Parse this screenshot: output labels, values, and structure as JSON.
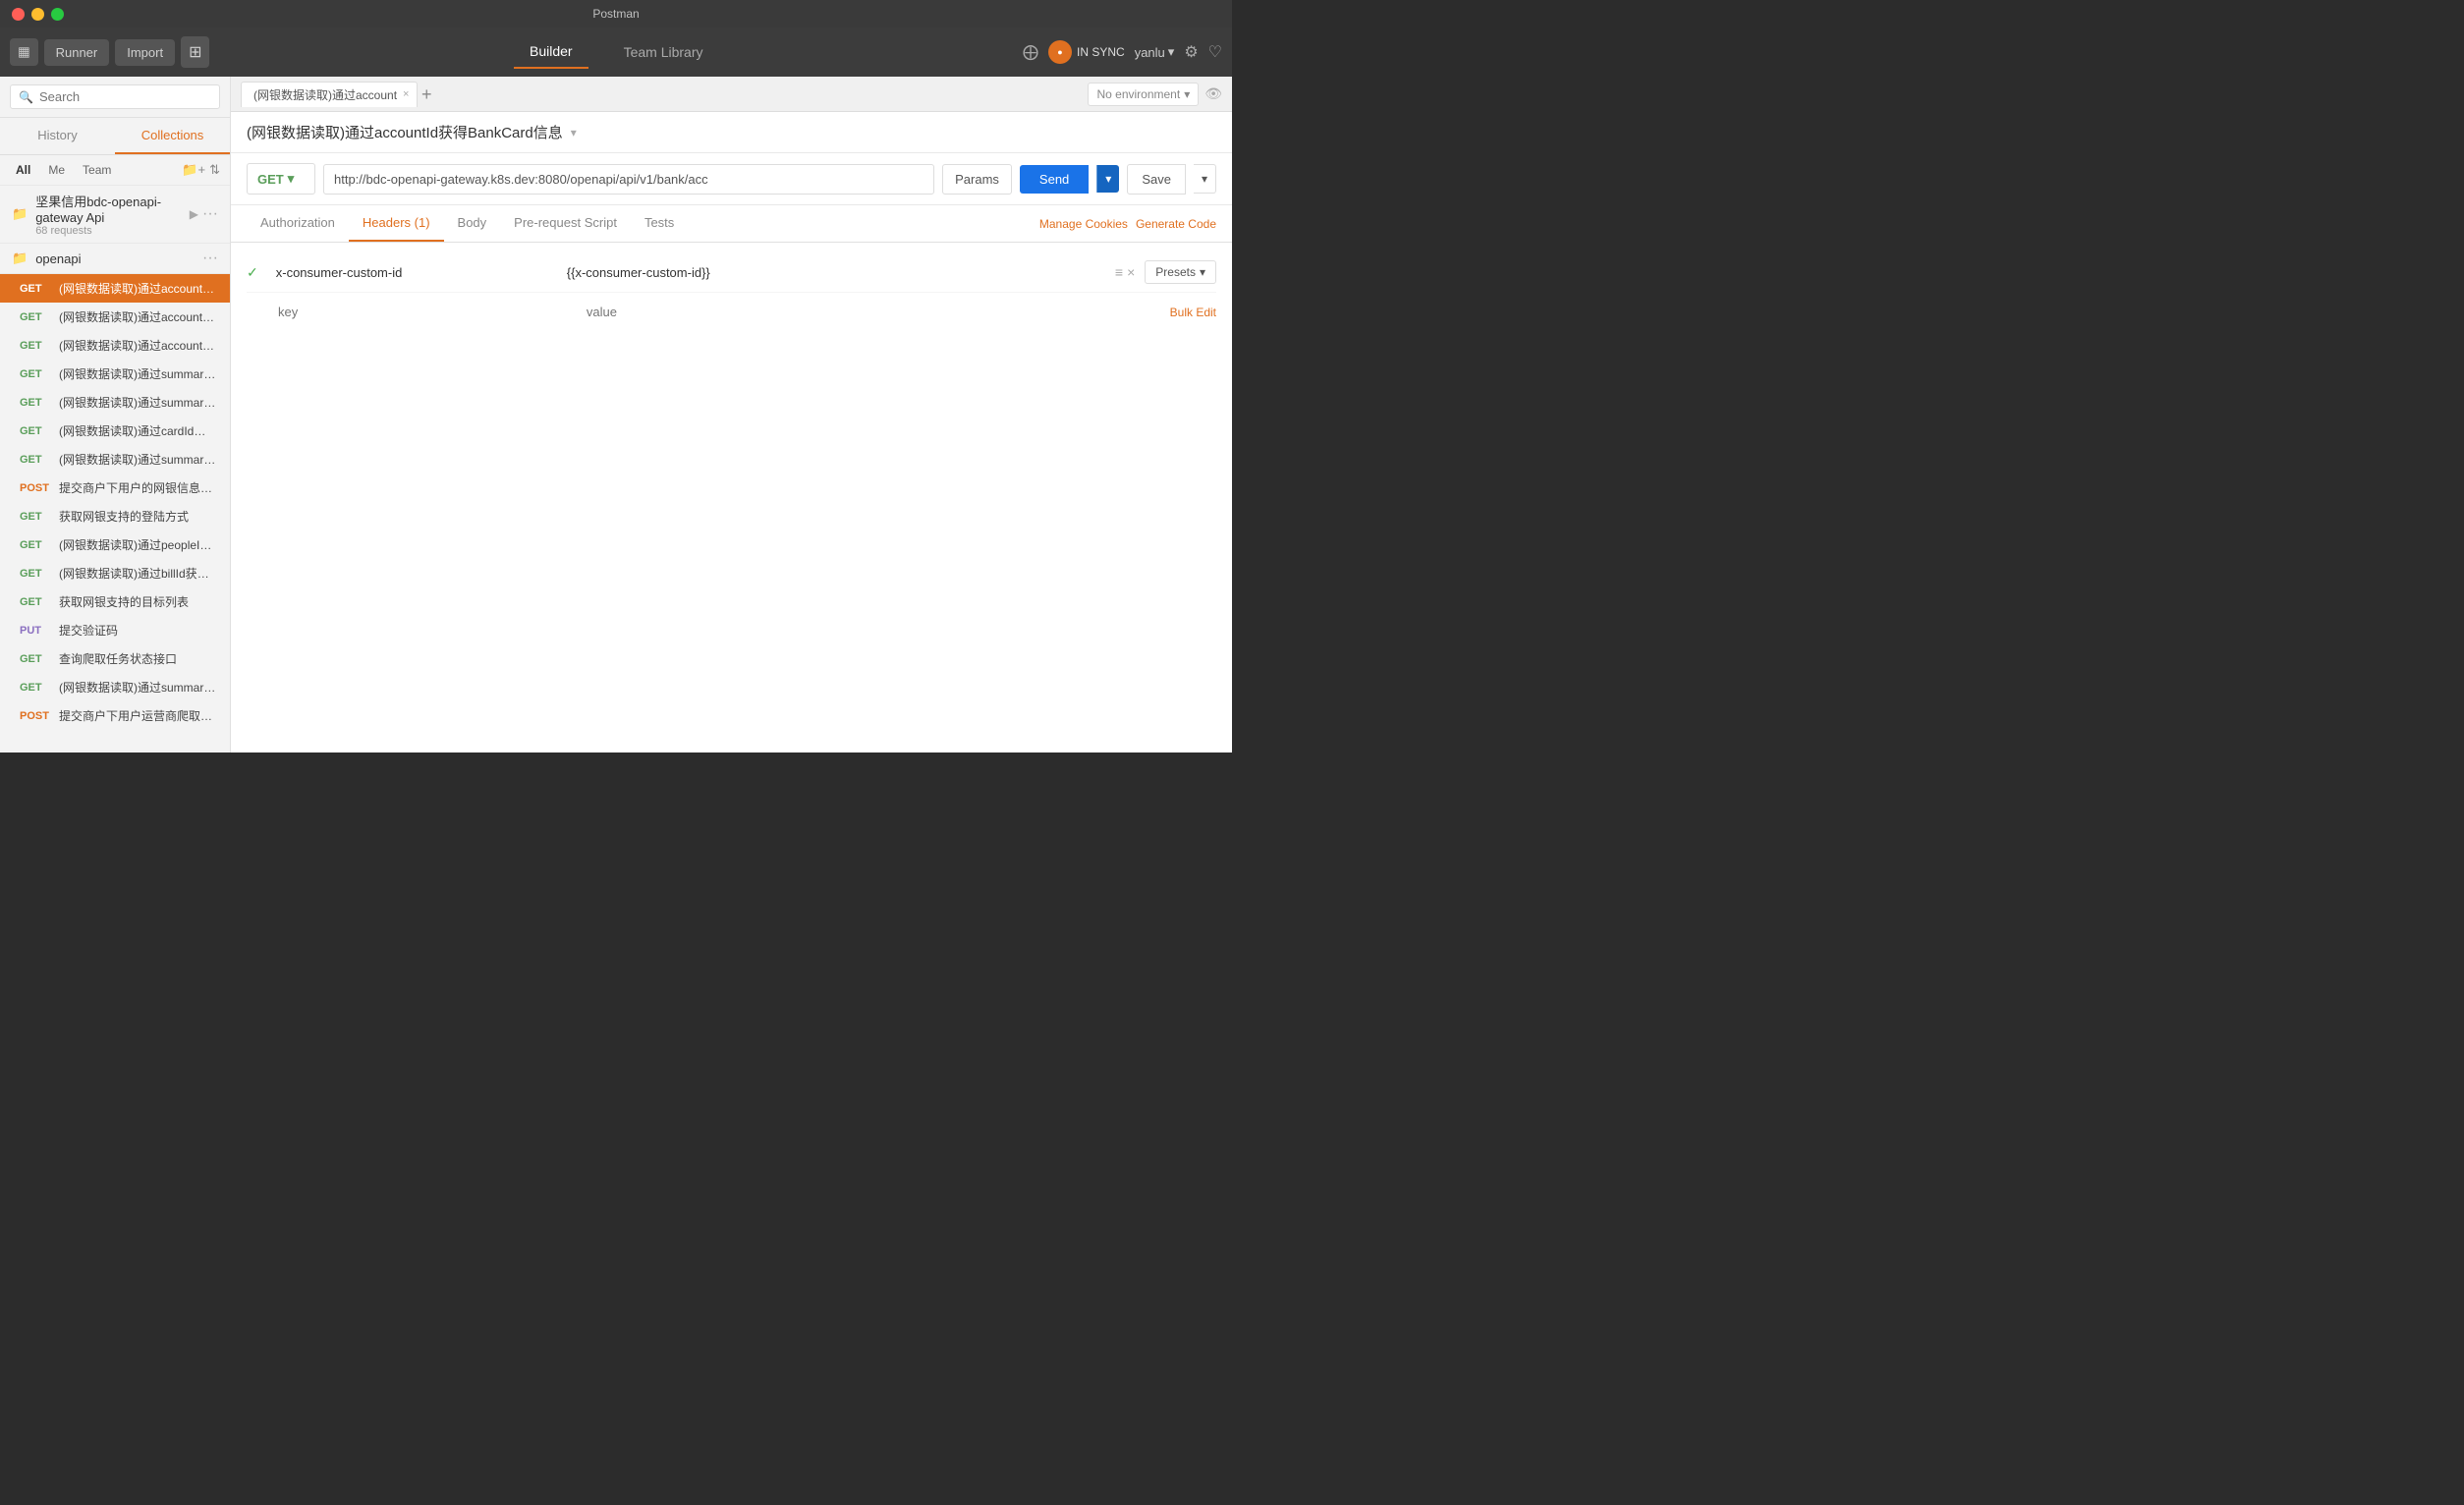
{
  "window": {
    "title": "Postman"
  },
  "titlebar": {
    "close": "×",
    "minimize": "−",
    "maximize": "+"
  },
  "toolbar": {
    "sidebar_toggle": "▤",
    "runner_label": "Runner",
    "import_label": "Import",
    "new_btn": "⊞",
    "builder_tab": "Builder",
    "team_library_tab": "Team Library",
    "sync_label": "IN SYNC",
    "user_label": "yanlu",
    "settings_icon": "⚙",
    "heart_icon": "♡",
    "network_icon": "⊕"
  },
  "sidebar": {
    "search_placeholder": "Search",
    "history_tab": "History",
    "collections_tab": "Collections",
    "filter_all": "All",
    "filter_me": "Me",
    "filter_team": "Team",
    "collections": [
      {
        "name": "坚果信用bdc-openapi-gateway Api",
        "count": "68 requests",
        "expanded": true
      },
      {
        "name": "openapi",
        "expanded": true
      }
    ],
    "requests": [
      {
        "method": "GET",
        "name": "(网银数据读取)通过accountId获得BankCard信息",
        "active": true
      },
      {
        "method": "GET",
        "name": "(网银数据读取)通过accountId查询账户信息"
      },
      {
        "method": "GET",
        "name": "(网银数据读取)通过accountId查询个人银行卡信..."
      },
      {
        "method": "GET",
        "name": "(网银数据读取)通过summaryId获得BankBill列..."
      },
      {
        "method": "GET",
        "name": "(网银数据读取)通过summaryId获得BankCard列..."
      },
      {
        "method": "GET",
        "name": "(网银数据读取)通过cardId获得BankCard信息"
      },
      {
        "method": "GET",
        "name": "(网银数据读取)通过summaryId获得BankBillSu..."
      },
      {
        "method": "POST",
        "name": "提交商户下用户的网银信息抓取任务"
      },
      {
        "method": "GET",
        "name": "获取网银支持的登陆方式"
      },
      {
        "method": "GET",
        "name": "(网银数据读取)通过peopleId获得people信息"
      },
      {
        "method": "GET",
        "name": "(网银数据读取)通过billId获得BankShoppingRec..."
      },
      {
        "method": "GET",
        "name": "获取网银支持的目标列表"
      },
      {
        "method": "PUT",
        "name": "提交验证码"
      },
      {
        "method": "GET",
        "name": "查询爬取任务状态接口"
      },
      {
        "method": "GET",
        "name": "(网银数据读取)通过summaryId获得银行账单摘..."
      },
      {
        "method": "POST",
        "name": "提交商户下用户运营商爬取任务"
      }
    ]
  },
  "main": {
    "tab_label": "(网银数据读取)通过account",
    "request_title": "(网银数据读取)通过accountId获得BankCard信息",
    "env_label": "No environment",
    "method": "GET",
    "url": "http://bdc-openapi-gateway.k8s.dev:8080/openapi/api/v1/bank/acc",
    "params_label": "Params",
    "send_label": "Send",
    "save_label": "Save",
    "tabs": [
      {
        "label": "Authorization"
      },
      {
        "label": "Headers (1)",
        "active": true
      },
      {
        "label": "Body"
      },
      {
        "label": "Pre-request Script"
      },
      {
        "label": "Tests"
      }
    ],
    "tab_actions": {
      "manage_cookies": "Manage Cookies",
      "generate_code": "Generate Code"
    },
    "headers": [
      {
        "enabled": true,
        "key": "x-consumer-custom-id",
        "value": "{{x-consumer-custom-id}}"
      }
    ],
    "new_header": {
      "key_placeholder": "key",
      "value_placeholder": "value",
      "bulk_edit": "Bulk Edit"
    },
    "presets_label": "Presets"
  }
}
